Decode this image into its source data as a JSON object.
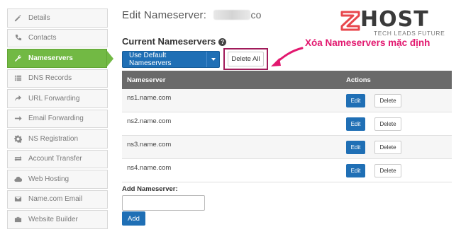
{
  "sidebar": {
    "items": [
      {
        "label": "Details",
        "icon": "pencil-icon"
      },
      {
        "label": "Contacts",
        "icon": "phone-icon"
      },
      {
        "label": "Nameservers",
        "icon": "wrench-icon"
      },
      {
        "label": "DNS Records",
        "icon": "list-icon"
      },
      {
        "label": "URL Forwarding",
        "icon": "share-icon"
      },
      {
        "label": "Email Forwarding",
        "icon": "arrow-right-icon"
      },
      {
        "label": "NS Registration",
        "icon": "gear-icon"
      },
      {
        "label": "Account Transfer",
        "icon": "transfer-icon"
      },
      {
        "label": "Web Hosting",
        "icon": "cloud-icon"
      },
      {
        "label": "Name.com Email",
        "icon": "envelope-icon"
      },
      {
        "label": "Website Builder",
        "icon": "briefcase-icon"
      }
    ],
    "active_index": 2,
    "active_color": "#72b944"
  },
  "header": {
    "title_prefix": "Edit Nameserver:",
    "domain_visible_tail": "co"
  },
  "section": {
    "title": "Current Nameservers",
    "help_icon": "question-circle-icon"
  },
  "toolbar": {
    "default_ns_label": "Use Default Nameservers",
    "delete_all_label": "Delete All"
  },
  "annotation": {
    "text": "Xóa Nameservers mặc định",
    "color": "#e2186f"
  },
  "logo": {
    "brand": "HOST",
    "tagline": "TECH LEADS FUTURE"
  },
  "table": {
    "headers": {
      "nameserver": "Nameserver",
      "actions": "Actions"
    },
    "edit_label": "Edit",
    "delete_label": "Delete",
    "rows": [
      {
        "nameserver": "ns1.name.com"
      },
      {
        "nameserver": "ns2.name.com"
      },
      {
        "nameserver": "ns3.name.com"
      },
      {
        "nameserver": "ns4.name.com"
      }
    ]
  },
  "add_form": {
    "label": "Add Nameserver:",
    "input_value": "",
    "button_label": "Add"
  },
  "colors": {
    "primary_button": "#1f6fb5",
    "table_header": "#6a6a6a",
    "highlight_box": "#a11b5a"
  }
}
